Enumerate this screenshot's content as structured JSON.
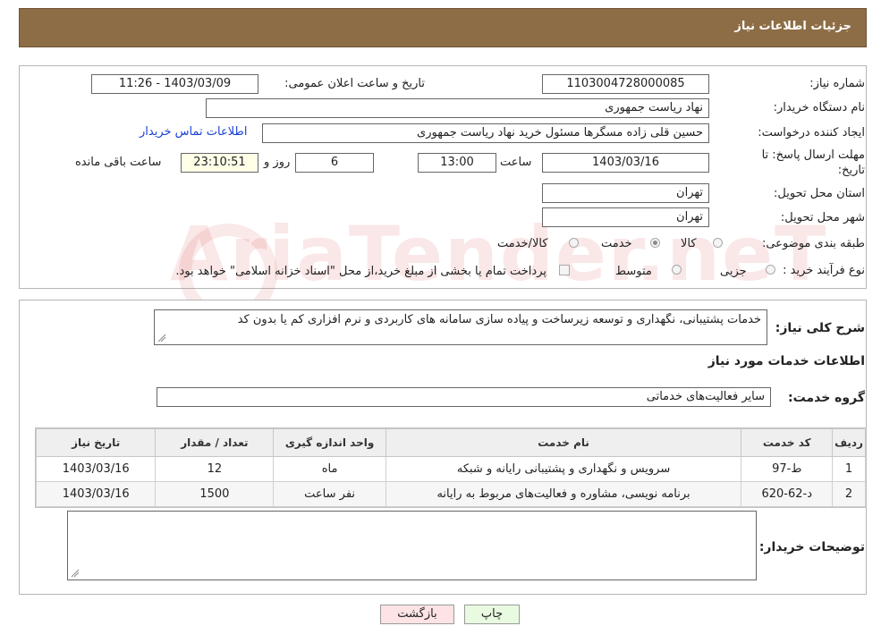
{
  "header": {
    "title": "جزئیات اطلاعات نیاز"
  },
  "form": {
    "need_number_label": "شماره نیاز:",
    "need_number": "1103004728000085",
    "announce_label": "تاریخ و ساعت اعلان عمومی:",
    "announce_value": "1403/03/09 - 11:26",
    "buyer_org_label": "نام دستگاه خریدار:",
    "buyer_org": "نهاد ریاست جمهوری",
    "creator_label": "ایجاد کننده درخواست:",
    "creator": "حسین قلی زاده مسگرها مسئول خرید نهاد ریاست جمهوری",
    "contact_link": "اطلاعات تماس خریدار",
    "deadline_label_1": "مهلت ارسال پاسخ: تا",
    "deadline_label_2": "تاریخ:",
    "deadline_date": "1403/03/16",
    "time_label": "ساعت",
    "deadline_time": "13:00",
    "days_value": "6",
    "days_label": "روز و",
    "remaining_time": "23:10:51",
    "remaining_label": "ساعت باقی مانده",
    "province_label": "استان محل تحویل:",
    "province": "تهران",
    "city_label": "شهر محل تحویل:",
    "city": "تهران",
    "category_label": "طبقه بندی موضوعی:",
    "category_options": [
      "کالا",
      "خدمت",
      "کالا/خدمت"
    ],
    "category_selected": "خدمت",
    "process_label": "نوع فرآیند خرید :",
    "process_options": [
      "جزیی",
      "متوسط"
    ],
    "payment_note": "پرداخت تمام یا بخشی از مبلغ خرید،از محل \"اسناد خزانه اسلامی\" خواهد بود."
  },
  "watermark": "AriaTender.neT",
  "description": {
    "label": "شرح کلی نیاز:",
    "value": "خدمات پشتیبانی، نگهداری و توسعه زیرساخت و پیاده سازی سامانه های کاربردی و نرم افزاری کم یا بدون کد"
  },
  "services": {
    "section_title": "اطلاعات خدمات مورد نیاز",
    "group_label": "گروه خدمت:",
    "group_value": "سایر فعالیت‌های خدماتی",
    "columns": [
      "ردیف",
      "کد خدمت",
      "نام خدمت",
      "واحد اندازه گیری",
      "تعداد / مقدار",
      "تاریخ نیاز"
    ],
    "rows": [
      [
        "1",
        "ط-97",
        "سرویس و نگهداری و پشتیبانی رایانه و شبکه",
        "ماه",
        "12",
        "1403/03/16"
      ],
      [
        "2",
        "د-62-620",
        "برنامه نویسی، مشاوره و فعالیت‌های مربوط به رایانه",
        "نفر ساعت",
        "1500",
        "1403/03/16"
      ]
    ]
  },
  "buyer_notes": {
    "label": "توضیحات خریدار:",
    "value": ""
  },
  "buttons": {
    "print": "چاپ",
    "back": "بازگشت"
  },
  "colors": {
    "header_bg": "#8d6d46",
    "print_bg": "#e8fbe0",
    "back_bg": "#fde3e3",
    "link": "#1a3fd6"
  }
}
